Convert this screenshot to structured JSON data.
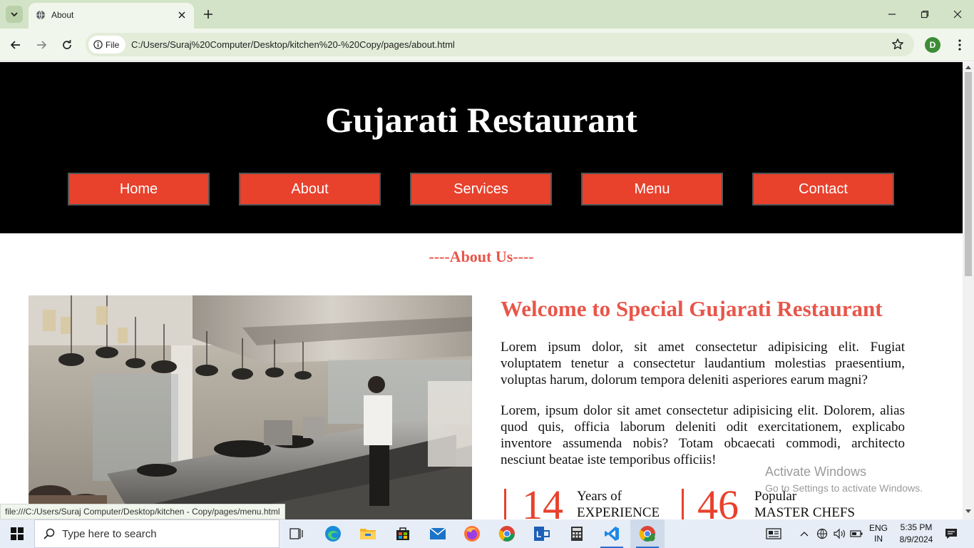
{
  "browser": {
    "tab_title": "About",
    "url_scheme_label": "File",
    "url": "C:/Users/Suraj%20Computer/Desktop/kitchen%20-%20Copy/pages/about.html",
    "profile_initial": "D",
    "status_url": "file:///C:/Users/Suraj Computer/Desktop/kitchen - Copy/pages/menu.html"
  },
  "site": {
    "title": "Gujarati Restaurant",
    "nav": [
      {
        "label": "Home"
      },
      {
        "label": "About"
      },
      {
        "label": "Services"
      },
      {
        "label": "Menu"
      },
      {
        "label": "Contact"
      }
    ],
    "about_heading": "----About Us----",
    "welcome_heading": "Welcome to Special Gujarati Restaurant",
    "paragraph1": "Lorem ipsum dolor, sit amet consectetur adipisicing elit. Fugiat voluptatem tenetur a consectetur laudantium molestias praesentium, voluptas harum, dolorum tempora deleniti asperiores earum magni?",
    "paragraph2": "Lorem, ipsum dolor sit amet consectetur adipisicing elit. Dolorem, alias quod quis, officia laborum deleniti odit exercitationem, explicabo inventore assumenda nobis? Totam obcaecati commodi, architecto nesciunt beatae iste temporibus officiis!",
    "stats": [
      {
        "number": "14",
        "line1": "Years of",
        "line2": "EXPERIENCE"
      },
      {
        "number": "46",
        "line1": "Popular",
        "line2": "MASTER CHEFS"
      }
    ]
  },
  "watermark": {
    "line1": "Activate Windows",
    "line2": "Go to Settings to activate Windows."
  },
  "taskbar": {
    "search_placeholder": "Type here to search",
    "apps": [
      "task-view",
      "edge",
      "file-explorer",
      "microsoft-store",
      "mail",
      "firefox",
      "chrome",
      "lightshot",
      "calculator",
      "vscode",
      "chrome-profile"
    ],
    "lang_line1": "ENG",
    "lang_line2": "IN",
    "time": "5:35 PM",
    "date": "8/9/2024"
  },
  "colors": {
    "accent": "#e8412c",
    "heading": "#e8564a",
    "header_bg": "#000000",
    "chrome_bg": "#d3e3c7"
  }
}
